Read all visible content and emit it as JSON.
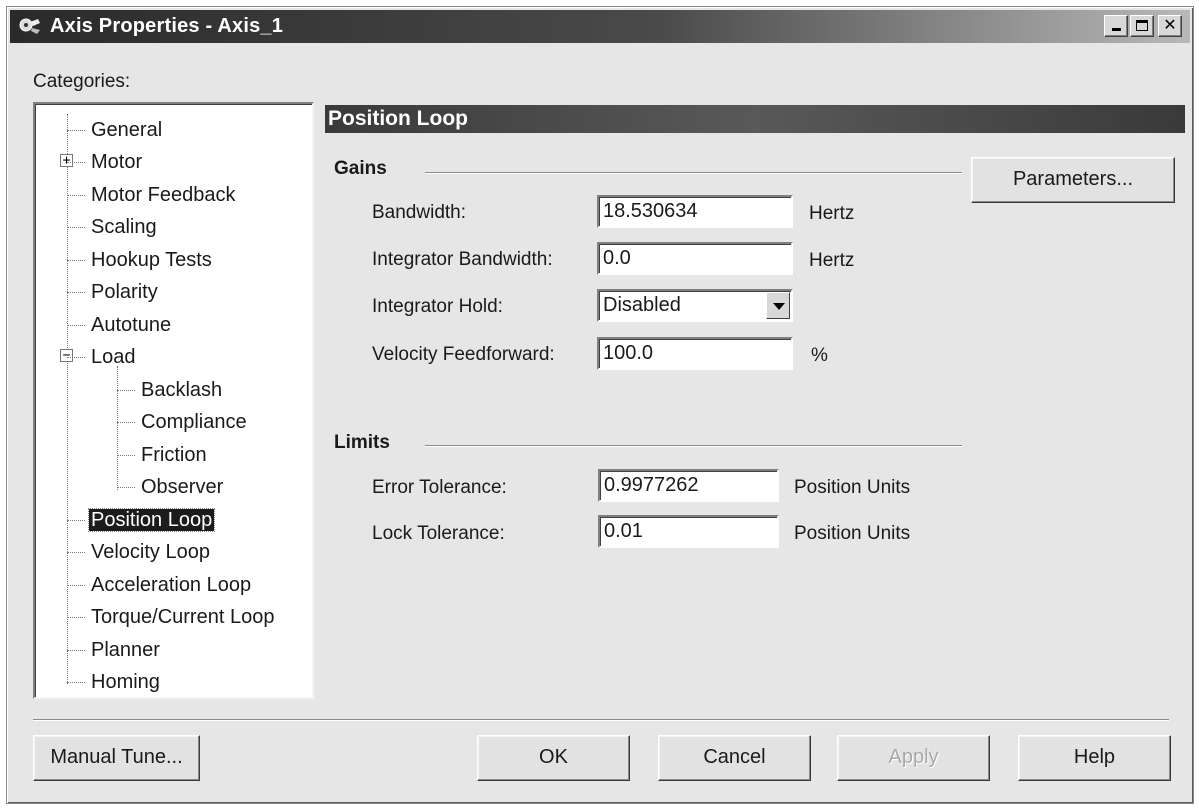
{
  "window": {
    "title": "Axis Properties - Axis_1",
    "controls": {
      "minimize": "_",
      "maximize": "□",
      "close": "✕"
    }
  },
  "categories": {
    "label": "Categories:",
    "items": [
      {
        "label": "General"
      },
      {
        "label": "Motor",
        "expander": "+"
      },
      {
        "label": "Motor Feedback"
      },
      {
        "label": "Scaling"
      },
      {
        "label": "Hookup Tests"
      },
      {
        "label": "Polarity"
      },
      {
        "label": "Autotune"
      },
      {
        "label": "Load",
        "expander": "−"
      },
      {
        "label": "Backlash"
      },
      {
        "label": "Compliance"
      },
      {
        "label": "Friction"
      },
      {
        "label": "Observer"
      },
      {
        "label": "Position Loop",
        "selected": true
      },
      {
        "label": "Velocity Loop"
      },
      {
        "label": "Acceleration Loop"
      },
      {
        "label": "Torque/Current Loop"
      },
      {
        "label": "Planner"
      },
      {
        "label": "Homing"
      }
    ]
  },
  "panel": {
    "title": "Position Loop",
    "parameters_button": "Parameters...",
    "gains": {
      "title": "Gains",
      "bandwidth": {
        "label": "Bandwidth:",
        "value": "18.530634",
        "unit": "Hertz"
      },
      "integrator_bandwidth": {
        "label": "Integrator Bandwidth:",
        "value": "0.0",
        "unit": "Hertz"
      },
      "integrator_hold": {
        "label": "Integrator Hold:",
        "value": "Disabled"
      },
      "velocity_feedforward": {
        "label": "Velocity Feedforward:",
        "value": "100.0",
        "unit": "%"
      }
    },
    "limits": {
      "title": "Limits",
      "error_tolerance": {
        "label": "Error Tolerance:",
        "value": "0.9977262",
        "unit": "Position Units"
      },
      "lock_tolerance": {
        "label": "Lock Tolerance:",
        "value": "0.01",
        "unit": "Position Units"
      }
    }
  },
  "buttons": {
    "manual_tune": "Manual Tune...",
    "ok": "OK",
    "cancel": "Cancel",
    "apply": "Apply",
    "help": "Help"
  }
}
